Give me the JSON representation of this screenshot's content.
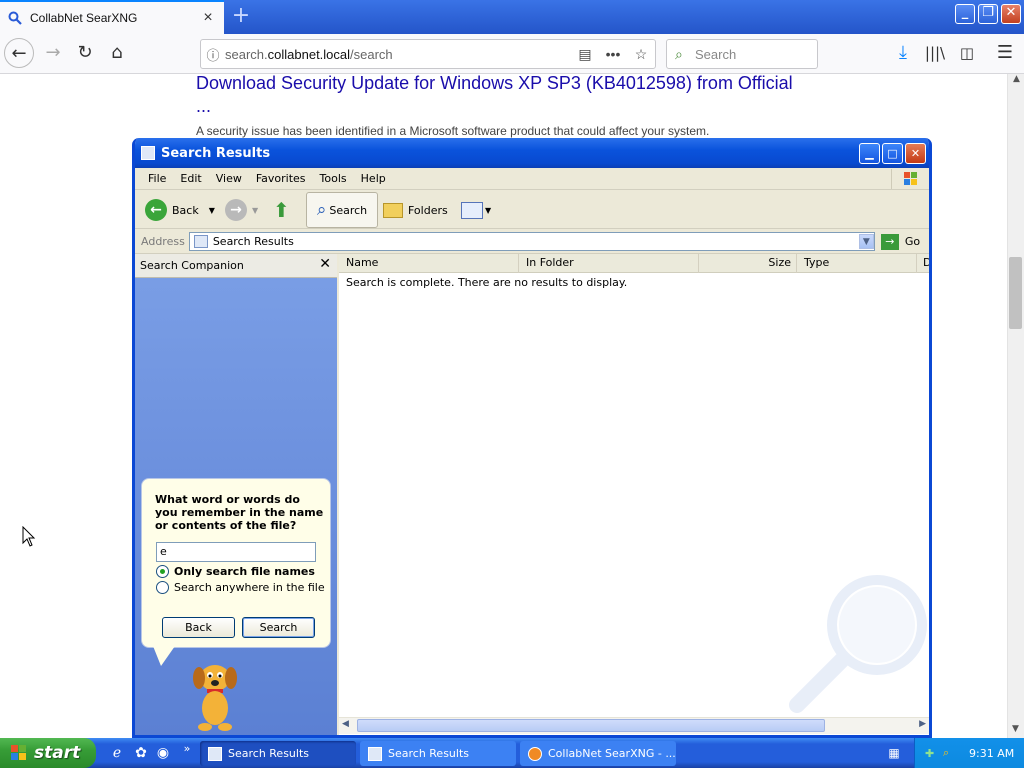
{
  "browser": {
    "tab_title": "CollabNet SearXNG",
    "tab_close": "×",
    "new_tab": "+",
    "url_host_prefix": "search.",
    "url_host": "collabnet.local",
    "url_path": "/search",
    "search_placeholder": "Search",
    "window_controls": {
      "minimize": "_",
      "maximize": "❐",
      "close": "✕"
    }
  },
  "page": {
    "result_title": "Download Security Update for Windows XP SP3 (KB4012598) from Official ...",
    "result_snippet": "A security issue has been identified in a Microsoft software product that could affect your system."
  },
  "explorer": {
    "title": "Search Results",
    "menu": [
      "File",
      "Edit",
      "View",
      "Favorites",
      "Tools",
      "Help"
    ],
    "toolbar": {
      "back": "Back",
      "search": "Search",
      "folders": "Folders"
    },
    "address_label": "Address",
    "address_value": "Search Results",
    "go_label": "Go",
    "companion": {
      "header": "Search Companion",
      "question": "What word or words do you remember in the name or contents of the file?",
      "query": "e",
      "radio_filenames": "Only search file names",
      "radio_anywhere": "Search anywhere in the file",
      "selected_radio": "Only search file names",
      "back_button": "Back",
      "search_button": "Search"
    },
    "columns": [
      "Name",
      "In Folder",
      "Size",
      "Type",
      "D"
    ],
    "result_message": "Search is complete. There are no results to display."
  },
  "taskbar": {
    "start": "start",
    "tasks": [
      "Search Results",
      "Search Results",
      "CollabNet SearXNG - ..."
    ],
    "clock": "9:31 AM",
    "overflow": "»"
  }
}
